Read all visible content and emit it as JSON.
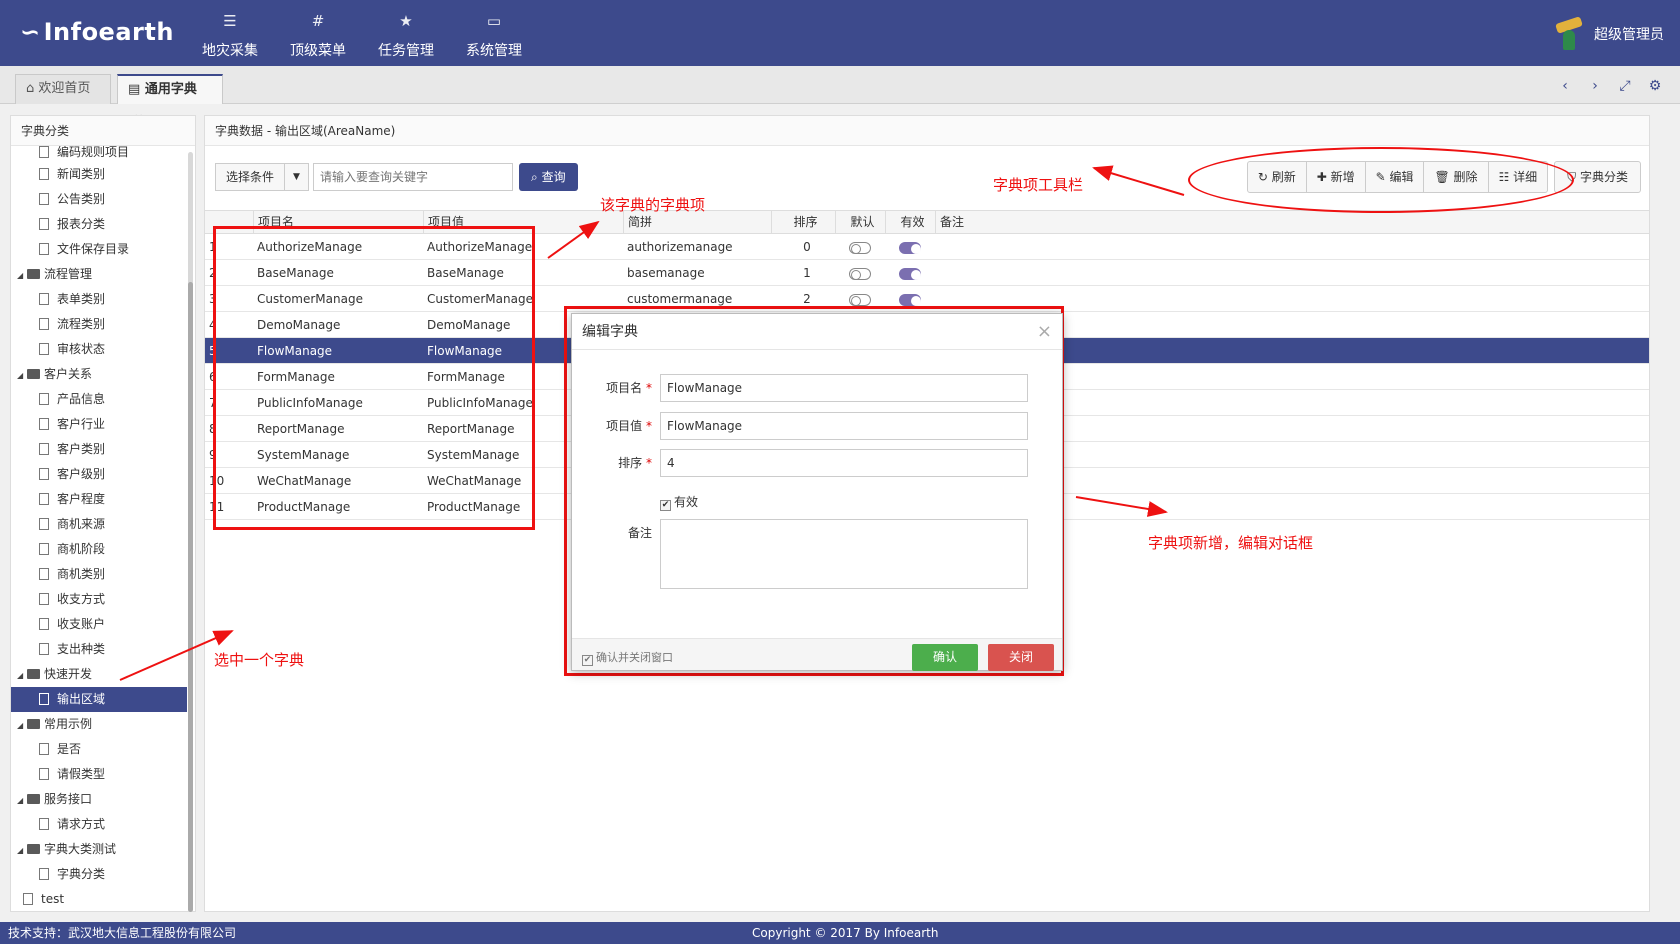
{
  "app": {
    "logo": "Infoearth",
    "nav": [
      {
        "label": "地灾采集",
        "icon": "menu-icon"
      },
      {
        "label": "顶级菜单",
        "icon": "hash-icon"
      },
      {
        "label": "任务管理",
        "icon": "star-icon"
      },
      {
        "label": "系统管理",
        "icon": "monitor-icon"
      }
    ],
    "user": "超级管理员"
  },
  "tabs": [
    {
      "label": "欢迎首页",
      "icon": "home-icon"
    },
    {
      "label": "通用字典",
      "icon": "book-icon"
    }
  ],
  "left": {
    "title": "字典分类",
    "tree": [
      {
        "label": "编码规则项目",
        "type": "file"
      },
      {
        "label": "新闻类别",
        "type": "file"
      },
      {
        "label": "公告类别",
        "type": "file"
      },
      {
        "label": "报表分类",
        "type": "file"
      },
      {
        "label": "文件保存目录",
        "type": "file"
      },
      {
        "label": "流程管理",
        "type": "folder"
      },
      {
        "label": "表单类别",
        "type": "file"
      },
      {
        "label": "流程类别",
        "type": "file"
      },
      {
        "label": "审核状态",
        "type": "file"
      },
      {
        "label": "客户关系",
        "type": "folder"
      },
      {
        "label": "产品信息",
        "type": "file"
      },
      {
        "label": "客户行业",
        "type": "file"
      },
      {
        "label": "客户类别",
        "type": "file"
      },
      {
        "label": "客户级别",
        "type": "file"
      },
      {
        "label": "客户程度",
        "type": "file"
      },
      {
        "label": "商机来源",
        "type": "file"
      },
      {
        "label": "商机阶段",
        "type": "file"
      },
      {
        "label": "商机类别",
        "type": "file"
      },
      {
        "label": "收支方式",
        "type": "file"
      },
      {
        "label": "收支账户",
        "type": "file"
      },
      {
        "label": "支出种类",
        "type": "file"
      },
      {
        "label": "快速开发",
        "type": "folder"
      },
      {
        "label": "输出区域",
        "type": "file",
        "selected": true
      },
      {
        "label": "常用示例",
        "type": "folder"
      },
      {
        "label": "是否",
        "type": "file"
      },
      {
        "label": "请假类型",
        "type": "file"
      },
      {
        "label": "服务接口",
        "type": "folder"
      },
      {
        "label": "请求方式",
        "type": "file"
      },
      {
        "label": "字典大类测试",
        "type": "folder"
      },
      {
        "label": "字典分类",
        "type": "file"
      },
      {
        "label": "test",
        "type": "file",
        "root": true
      }
    ]
  },
  "main": {
    "title": "字典数据 - 输出区域(AreaName)",
    "select_label": "选择条件",
    "search_placeholder": "请输入要查询关键字",
    "query_label": "查询",
    "buttons": {
      "refresh": "刷新",
      "add": "新增",
      "edit": "编辑",
      "delete": "删除",
      "detail": "详细",
      "category": "字典分类"
    },
    "columns": [
      "项目名",
      "项目值",
      "简拼",
      "排序",
      "默认",
      "有效",
      "备注"
    ],
    "rows": [
      {
        "no": "1",
        "name": "AuthorizeManage",
        "value": "AuthorizeManage",
        "pinyin": "authorizemanage",
        "sort": "0",
        "def": false,
        "valid": true
      },
      {
        "no": "2",
        "name": "BaseManage",
        "value": "BaseManage",
        "pinyin": "basemanage",
        "sort": "1",
        "def": false,
        "valid": true
      },
      {
        "no": "3",
        "name": "CustomerManage",
        "value": "CustomerManage",
        "pinyin": "customermanage",
        "sort": "2",
        "def": false,
        "valid": true
      },
      {
        "no": "4",
        "name": "DemoManage",
        "value": "DemoManage",
        "pinyin": "",
        "sort": "",
        "def": null,
        "valid": null
      },
      {
        "no": "5",
        "name": "FlowManage",
        "value": "FlowManage",
        "pinyin": "",
        "sort": "",
        "def": null,
        "valid": null,
        "selected": true
      },
      {
        "no": "6",
        "name": "FormManage",
        "value": "FormManage",
        "pinyin": "",
        "sort": "",
        "def": null,
        "valid": null
      },
      {
        "no": "7",
        "name": "PublicInfoManage",
        "value": "PublicInfoManage",
        "pinyin": "",
        "sort": "",
        "def": null,
        "valid": null
      },
      {
        "no": "8",
        "name": "ReportManage",
        "value": "ReportManage",
        "pinyin": "",
        "sort": "",
        "def": null,
        "valid": null
      },
      {
        "no": "9",
        "name": "SystemManage",
        "value": "SystemManage",
        "pinyin": "",
        "sort": "",
        "def": null,
        "valid": null
      },
      {
        "no": "10",
        "name": "WeChatManage",
        "value": "WeChatManage",
        "pinyin": "",
        "sort": "",
        "def": null,
        "valid": null
      },
      {
        "no": "11",
        "name": "ProductManage",
        "value": "ProductManage",
        "pinyin": "",
        "sort": "",
        "def": null,
        "valid": null
      }
    ]
  },
  "modal": {
    "title": "编辑字典",
    "fields": {
      "name_label": "项目名",
      "name_value": "FlowManage",
      "value_label": "项目值",
      "value_value": "FlowManage",
      "sort_label": "排序",
      "sort_value": "4",
      "valid_label": "有效",
      "remark_label": "备注"
    },
    "keep_label": "确认并关闭窗口",
    "ok_label": "确认",
    "close_label": "关闭"
  },
  "annotations": {
    "items_note": "该字典的字典项",
    "toolbar_note": "字典项工具栏",
    "dialog_note": "字典项新增，编辑对话框",
    "select_note": "选中一个字典",
    "color": "#ee1111"
  },
  "footer": {
    "support": "技术支持：武汉地大信息工程股份有限公司",
    "copyright": "Copyright © 2017 By Infoearth"
  },
  "colors": {
    "brand": "#3d4a8c",
    "ok": "#4cae4c",
    "close": "#d9534f"
  }
}
